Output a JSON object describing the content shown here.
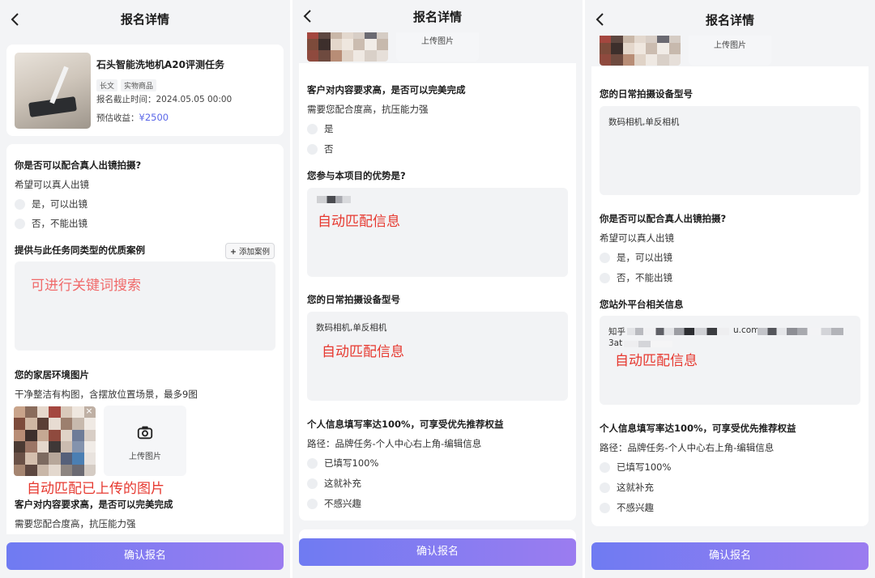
{
  "page_title": "报名详情",
  "confirm_button": "确认报名",
  "task": {
    "name": "石头智能洗地机A20评测任务",
    "tags": [
      "长文",
      "实物商品"
    ],
    "deadline": "报名截止时间：2024.05.05 00:00",
    "earnings_label": "预估收益：",
    "earnings_value": "¥2500"
  },
  "questions": {
    "oncamera": {
      "title": "你是否可以配合真人出镜拍摄?",
      "hint": "希望可以真人出镜",
      "options": [
        "是，可以出镜",
        "否，不能出镜"
      ]
    },
    "cases": {
      "title": "提供与此任务同类型的优质案例",
      "add_label": "添加案例"
    },
    "home": {
      "title": "您的家居环境图片",
      "hint": "干净整洁有构图，含摆放位置场景，最多9图"
    },
    "perfection": {
      "title": "客户对内容要求高，是否可以完美完成",
      "hint": "需要您配合度高，抗压能力强",
      "options": [
        "是",
        "否"
      ]
    },
    "advantage": {
      "title": "您参与本项目的优势是?"
    },
    "device": {
      "title": "您的日常拍摄设备型号",
      "value": "数码相机,单反相机"
    },
    "offsite": {
      "title": "您站外平台相关信息",
      "value_line1_prefix": "知乎",
      "value_line1_mid": "u.com",
      "value_line2_prefix": "3at"
    },
    "profile": {
      "title": "个人信息填写率达100%，可享受优先推荐权益",
      "path": "路径：品牌任务-个人中心右上角-编辑信息",
      "options": [
        "已填写100%",
        "这就补充",
        "不感兴趣"
      ]
    }
  },
  "upload_label": "上传图片",
  "annotations": {
    "keyword_search": "可进行关键词搜索",
    "auto_match_uploaded": "自动匹配已上传的图片",
    "auto_match": "自动匹配信息"
  },
  "colors": {
    "accent": "#6f7bf2",
    "accent_end": "#9b7cf0",
    "price": "#5a67e8",
    "annotation": "#e6382f"
  }
}
